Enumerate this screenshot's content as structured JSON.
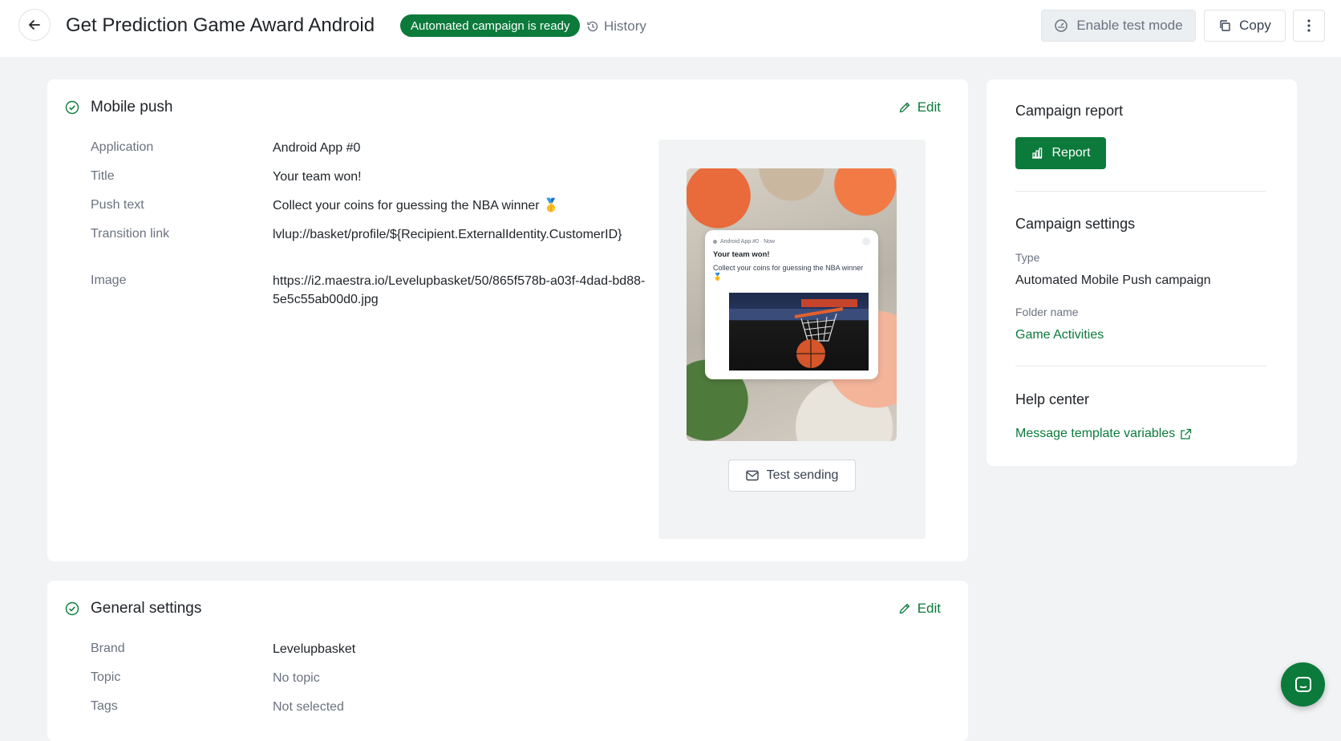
{
  "header": {
    "title": "Get Prediction Game Award Android",
    "status_badge": "Automated campaign is ready",
    "history_label": "History",
    "enable_test_label": "Enable test mode",
    "copy_label": "Copy"
  },
  "mobile_push": {
    "heading": "Mobile push",
    "edit_label": "Edit",
    "fields": [
      {
        "label": "Application",
        "value": "Android App #0"
      },
      {
        "label": "Title",
        "value": "Your team won!"
      },
      {
        "label": "Push text",
        "value": "Collect your coins for guessing the NBA winner 🥇"
      },
      {
        "label": "Transition link",
        "value": "lvlup://basket/profile/${Recipient.ExternalIdentity.CustomerID}"
      },
      {
        "label": "Image",
        "value": "https://i2.maestra.io/Levelupbasket/50/865f578b-a03f-4dad-bd88-5e5c55ab00d0.jpg"
      }
    ],
    "preview": {
      "app_line": "Android App #0 · Now",
      "title": "Your team won!",
      "body": "Collect your coins for guessing the NBA winner 🥇"
    },
    "test_sending_label": "Test sending"
  },
  "general_settings": {
    "heading": "General settings",
    "edit_label": "Edit",
    "fields": [
      {
        "label": "Brand",
        "value": "Levelupbasket"
      },
      {
        "label": "Topic",
        "value": "No topic"
      },
      {
        "label": "Tags",
        "value": "Not selected"
      }
    ]
  },
  "sidebar": {
    "report_heading": "Campaign report",
    "report_button": "Report",
    "settings_heading": "Campaign settings",
    "type_label": "Type",
    "type_value": "Automated Mobile Push campaign",
    "folder_label": "Folder name",
    "folder_value": "Game Activities",
    "help_heading": "Help center",
    "help_link": "Message template variables"
  },
  "colors": {
    "accent": "#0b7a3b",
    "background": "#f1f3f4"
  }
}
